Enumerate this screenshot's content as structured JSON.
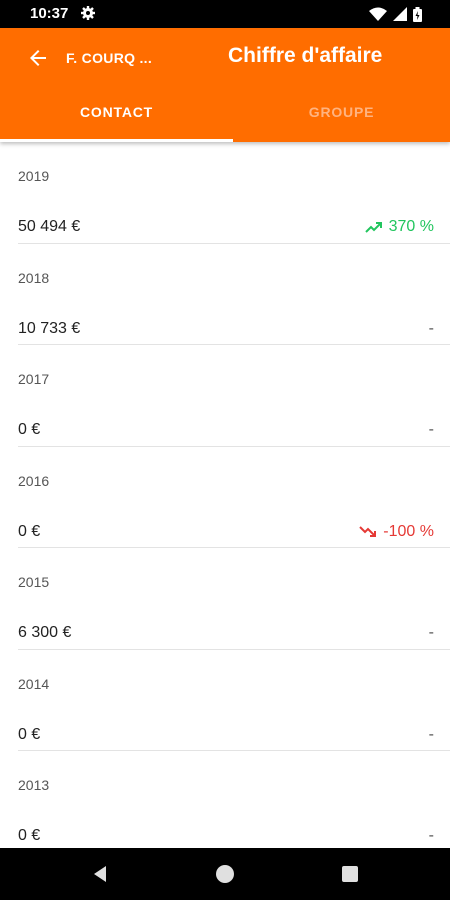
{
  "status_bar": {
    "time": "10:37"
  },
  "header": {
    "contact_name": "F. COURQ ...",
    "title": "Chiffre d'affaire",
    "tabs": [
      {
        "label": "CONTACT",
        "active": true
      },
      {
        "label": "GROUPE",
        "active": false
      }
    ]
  },
  "colors": {
    "accent": "#FF6D00",
    "trend_up": "#22C55E",
    "trend_down": "#E53935"
  },
  "entries": [
    {
      "year": "2019",
      "amount": "50 494 €",
      "trend": "370 %",
      "trend_type": "up",
      "trend_icon": "trending-up-icon"
    },
    {
      "year": "2018",
      "amount": "10 733 €",
      "trend": "-",
      "trend_type": "none"
    },
    {
      "year": "2017",
      "amount": "0 €",
      "trend": "-",
      "trend_type": "none"
    },
    {
      "year": "2016",
      "amount": "0 €",
      "trend": "-100 %",
      "trend_type": "down",
      "trend_icon": "trending-down-icon"
    },
    {
      "year": "2015",
      "amount": "6 300 €",
      "trend": "-",
      "trend_type": "none"
    },
    {
      "year": "2014",
      "amount": "0 €",
      "trend": "-",
      "trend_type": "none"
    },
    {
      "year": "2013",
      "amount": "0 €",
      "trend": "-",
      "trend_type": "none"
    }
  ]
}
